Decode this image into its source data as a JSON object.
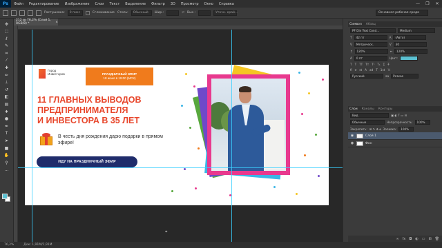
{
  "app": {
    "logo": "Ps",
    "menu": [
      "Файл",
      "Редактирование",
      "Изображение",
      "Слои",
      "Текст",
      "Выделение",
      "Фильтр",
      "3D",
      "Просмотр",
      "Окно",
      "Справка"
    ],
    "window_controls": [
      "—",
      "❐",
      "✕"
    ]
  },
  "options_bar": {
    "feather_label": "Растушевка:",
    "feather_value": "0 пикс",
    "antialias_label": "Сглаживание",
    "style_label": "Стиль:",
    "style_value": "Обычный",
    "width_label": "Шир.:",
    "height_label": "Выс.:",
    "refine_button": "Уточн. край...",
    "workspace": "Основная рабочая среда"
  },
  "document_tab": {
    "title": "212 @ 76,2% (Слой 1, RGB/8) *",
    "close": "×"
  },
  "artwork": {
    "logo_text": "Город Инвесторов",
    "badge_line1": "ПРАЗДНИЧНЫЙ ЭФИР",
    "badge_line2": "18 июня в 19:00 (МСК)",
    "headline": [
      "11 ГЛАВНЫХ ВЫВОДОВ",
      "ПРЕДПРИНИМАТЕЛЯ",
      "И ИНВЕСТОРА В 35 ЛЕТ"
    ],
    "subtext": "В честь дня рождения дарю подарки в прямом эфире!",
    "cta": "ИДУ НА ПРАЗДНИЧНЫЙ ЭФИР"
  },
  "colors": {
    "accent_orange": "#f07b1c",
    "headline_red": "#e8462b",
    "cta_navy": "#1f2c6b",
    "frame_pink": "#e8398e",
    "guide_cyan": "#39d0ff",
    "foreground_swatch": "#5bc0d1"
  },
  "status_bar": {
    "zoom": "76,2%",
    "doc_size": "Док: 1,91М/1,91М"
  },
  "character_panel": {
    "tabs": [
      "Символ",
      "Абзац"
    ],
    "font_family": "PF Din Text Cond...",
    "font_style": "Medium",
    "font_size": "42 пт",
    "leading": "(Авто)",
    "kerning": "Метрическ.",
    "tracking": "30",
    "vscale": "120%",
    "hscale": "120%",
    "baseline": "0 пт",
    "color_label": "Цвет:",
    "color_value": "#5bc0d1",
    "language": "Русский",
    "antialias": "Резкое"
  },
  "layers_panel": {
    "tabs": [
      "Слои",
      "Каналы",
      "Контуры"
    ],
    "filter": "Вид",
    "blend_mode": "Обычные",
    "opacity_label": "Непрозрачность:",
    "opacity_value": "100%",
    "lock_label": "Закрепить:",
    "fill_label": "Заливка:",
    "fill_value": "100%",
    "layers": [
      {
        "name": "Слой 1",
        "selected": true
      },
      {
        "name": "Фон",
        "selected": false
      }
    ],
    "footer_icons": [
      "link-icon",
      "fx-icon",
      "mask-icon",
      "adjust-icon",
      "folder-icon",
      "new-layer-icon",
      "trash-icon"
    ]
  },
  "tools": [
    "move-icon",
    "marquee-icon",
    "lasso-icon",
    "quick-select-icon",
    "crop-icon",
    "eyedropper-icon",
    "heal-icon",
    "brush-icon",
    "stamp-icon",
    "history-brush-icon",
    "eraser-icon",
    "gradient-icon",
    "blur-icon",
    "dodge-icon",
    "pen-icon",
    "type-icon",
    "path-select-icon",
    "shape-icon",
    "hand-icon",
    "zoom-icon",
    "more-icon"
  ]
}
